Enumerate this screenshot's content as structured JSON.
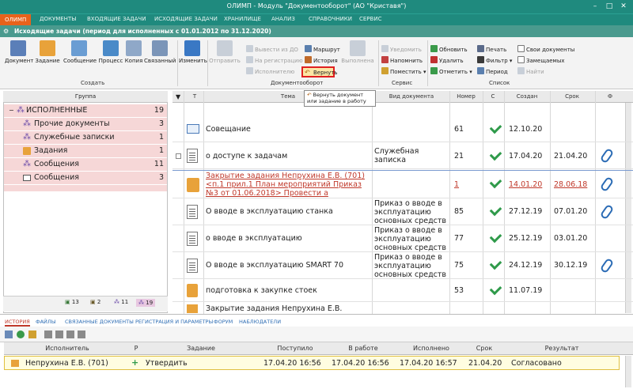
{
  "window": {
    "title": "ОЛИМП - Модуль \"Документооборот\" (АО \"Криставя\")"
  },
  "menu": [
    "ОЛИМП",
    "ДОКУМЕНТЫ",
    "ВХОДЯЩИЕ ЗАДАЧИ",
    "ИСХОДЯЩИЕ ЗАДАЧИ",
    "ХРАНИЛИЩЕ",
    "АНАЛИЗ",
    "СПРАВОЧНИКИ",
    "СЕРВИС"
  ],
  "doc_title": "Исходящие задачи (период для исполненных с 01.01.2012 по 31.12.2020)",
  "ribbon": {
    "create": [
      "Документ",
      "Задание",
      "Сообщение",
      "Процесс",
      "Копия",
      "Связанный"
    ],
    "create_group": "Создать",
    "edit": "Изменить",
    "send": "Отправить",
    "docflow_small": [
      "Вывести из ДО",
      "На регистрацию",
      "Исполнителю"
    ],
    "route": [
      "Маршрут",
      "История",
      "Вернуть"
    ],
    "done": "Выполнена",
    "docflow_group": "Документооборот",
    "service_small": [
      "Уведомить",
      "Напомнить",
      "Поместить"
    ],
    "service_group": "Сервис",
    "list_small": [
      "Обновить",
      "Удалить",
      "Отметить"
    ],
    "list_small2": [
      "Печать",
      "Фильтр",
      "Период"
    ],
    "list_checks": [
      "Свои документы",
      "Замещаемых",
      "Найти"
    ],
    "list_group": "Список"
  },
  "tooltip": "Вернуть документ или задание в работу",
  "left": {
    "header": "Группа",
    "items": [
      {
        "label": "ИСПОЛНЕННЫЕ",
        "count": "19"
      },
      {
        "label": "Прочие документы",
        "count": "3"
      },
      {
        "label": "Служебные записки",
        "count": "1"
      },
      {
        "label": "Задания",
        "count": "1"
      },
      {
        "label": "Сообщения",
        "count": "11"
      },
      {
        "label": "Сообщения",
        "count": "3"
      }
    ],
    "bottom": [
      "13",
      "2",
      "11",
      "19"
    ]
  },
  "grid": {
    "headers": {
      "t": "Т",
      "tema": "Тема",
      "vid": "Вид документа",
      "nomer": "Номер",
      "s": "С",
      "sozdan": "Создан",
      "srok": "Срок",
      "f": "Ф"
    },
    "rows": [
      {
        "tema": "Совещание",
        "vid": "",
        "nomer": "61",
        "sozdan": "12.10.20",
        "srok": ""
      },
      {
        "tema": "о доступе к задачам",
        "vid": "Служебная записка",
        "nomer": "21",
        "sozdan": "17.04.20",
        "srok": "21.04.20"
      },
      {
        "tema": "Закрытие задания Непрухина Е.В. (701) <п.1 прил.1 План мероприятий Приказ №3 от 01.06.2018> Провести а",
        "vid": "",
        "nomer": "1",
        "sozdan": "14.01.20",
        "srok": "28.06.18"
      },
      {
        "tema": "О вводе в эксплуатацию станка",
        "vid": "Приказ о вводе в эксплуатацию основных средств",
        "nomer": "85",
        "sozdan": "27.12.19",
        "srok": "07.01.20"
      },
      {
        "tema": "о вводе в эксплуатацию",
        "vid": "Приказ о вводе в эксплуатацию основных средств",
        "nomer": "77",
        "sozdan": "25.12.19",
        "srok": "03.01.20"
      },
      {
        "tema": "О вводе в эксплуатацию SMART 70",
        "vid": "Приказ о вводе в эксплуатацию основных средств",
        "nomer": "75",
        "sozdan": "24.12.19",
        "srok": "30.12.19"
      },
      {
        "tema": "подготовка к закупке стоек",
        "vid": "",
        "nomer": "53",
        "sozdan": "11.07.19",
        "srok": ""
      },
      {
        "tema": "Закрытие задания Непрухина Е.В.",
        "vid": "",
        "nomer": "",
        "sozdan": "",
        "srok": ""
      }
    ]
  },
  "tabs": [
    "ИСТОРИЯ",
    "ФАЙЛЫ",
    "СВЯЗАННЫЕ ДОКУМЕНТЫ",
    "РЕГИСТРАЦИЯ И ПАРАМЕТРЫ",
    "ФОРУМ",
    "НАБЛЮДАТЕЛИ"
  ],
  "history": {
    "headers": [
      "Исполнитель",
      "Р",
      "Задание",
      "Поступило",
      "В работе",
      "Исполнено",
      "Срок",
      "Результат"
    ],
    "row": [
      "Непрухина Е.В. (701)",
      "Утвердить",
      "17.04.20 16:56",
      "17.04.20 16:56",
      "17.04.20 16:57",
      "21.04.20",
      "Согласовано"
    ]
  }
}
